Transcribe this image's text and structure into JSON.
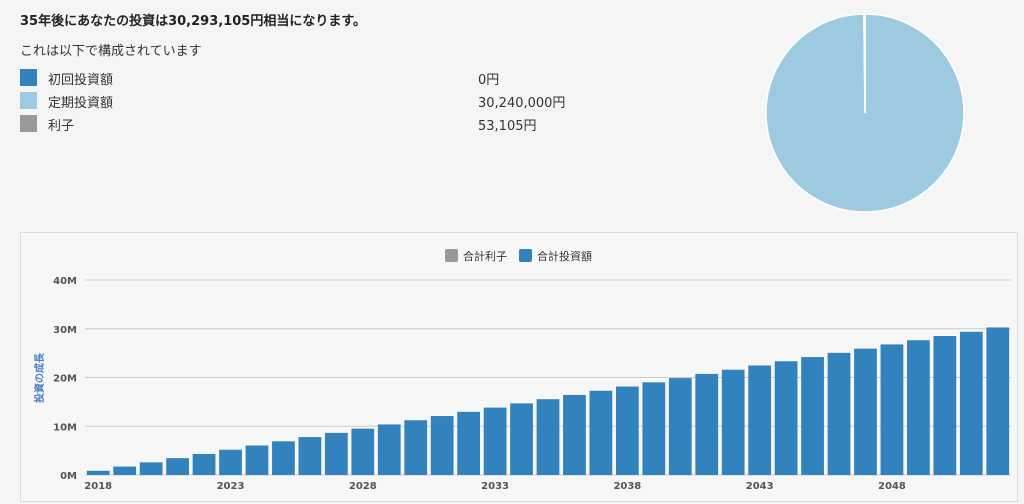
{
  "headline": "35年後にあなたの投資は30,293,105円相当になります。",
  "composition_intro": "これは以下で構成されています",
  "breakdown": [
    {
      "label": "初回投資額",
      "value": "0円",
      "color": "#3182bd"
    },
    {
      "label": "定期投資額",
      "value": "30,240,000円",
      "color": "#9ecae1"
    },
    {
      "label": "利子",
      "value": "53,105円",
      "color": "#999999"
    }
  ],
  "colors": {
    "interest": "#999999",
    "invested": "#3182bd",
    "regular": "#9ecae1",
    "gridline": "#cccccc"
  },
  "chart_data": [
    {
      "type": "pie",
      "labels": [
        "初回投資額",
        "定期投資額",
        "利子"
      ],
      "values": [
        0,
        30240000,
        53105
      ],
      "colors": [
        "#3182bd",
        "#9ecae1",
        "#999999"
      ]
    },
    {
      "type": "bar",
      "stacked": true,
      "legend": [
        "合計利子",
        "合計投資額"
      ],
      "legend_position": "top-center",
      "ylabel": "投資の成長",
      "ylim": [
        0,
        40000000
      ],
      "yticks": [
        "0M",
        "10M",
        "20M",
        "30M",
        "40M"
      ],
      "xticks": [
        "2018",
        "2023",
        "2028",
        "2033",
        "2038",
        "2043",
        "2048"
      ],
      "grid": true,
      "x": [
        2018,
        2019,
        2020,
        2021,
        2022,
        2023,
        2024,
        2025,
        2026,
        2027,
        2028,
        2029,
        2030,
        2031,
        2032,
        2033,
        2034,
        2035,
        2036,
        2037,
        2038,
        2039,
        2040,
        2041,
        2042,
        2043,
        2044,
        2045,
        2046,
        2047,
        2048,
        2049,
        2050,
        2051,
        2052
      ],
      "series": [
        {
          "name": "合計利子",
          "values": [
            0,
            0,
            0,
            0,
            0,
            0,
            0,
            0,
            0,
            0,
            0,
            0,
            0,
            0,
            0,
            0,
            0,
            0,
            0,
            0,
            0,
            0,
            0,
            0,
            0,
            0,
            0,
            0,
            0,
            0,
            0,
            0,
            0,
            0,
            53105
          ]
        },
        {
          "name": "合計投資額",
          "values": [
            864000,
            1728000,
            2592000,
            3456000,
            4320000,
            5184000,
            6048000,
            6912000,
            7776000,
            8640000,
            9504000,
            10368000,
            11232000,
            12096000,
            12960000,
            13824000,
            14688000,
            15552000,
            16416000,
            17280000,
            18144000,
            19008000,
            19872000,
            20736000,
            21600000,
            22464000,
            23328000,
            24192000,
            25056000,
            25920000,
            26784000,
            27648000,
            28512000,
            29376000,
            30240000
          ]
        }
      ]
    }
  ]
}
